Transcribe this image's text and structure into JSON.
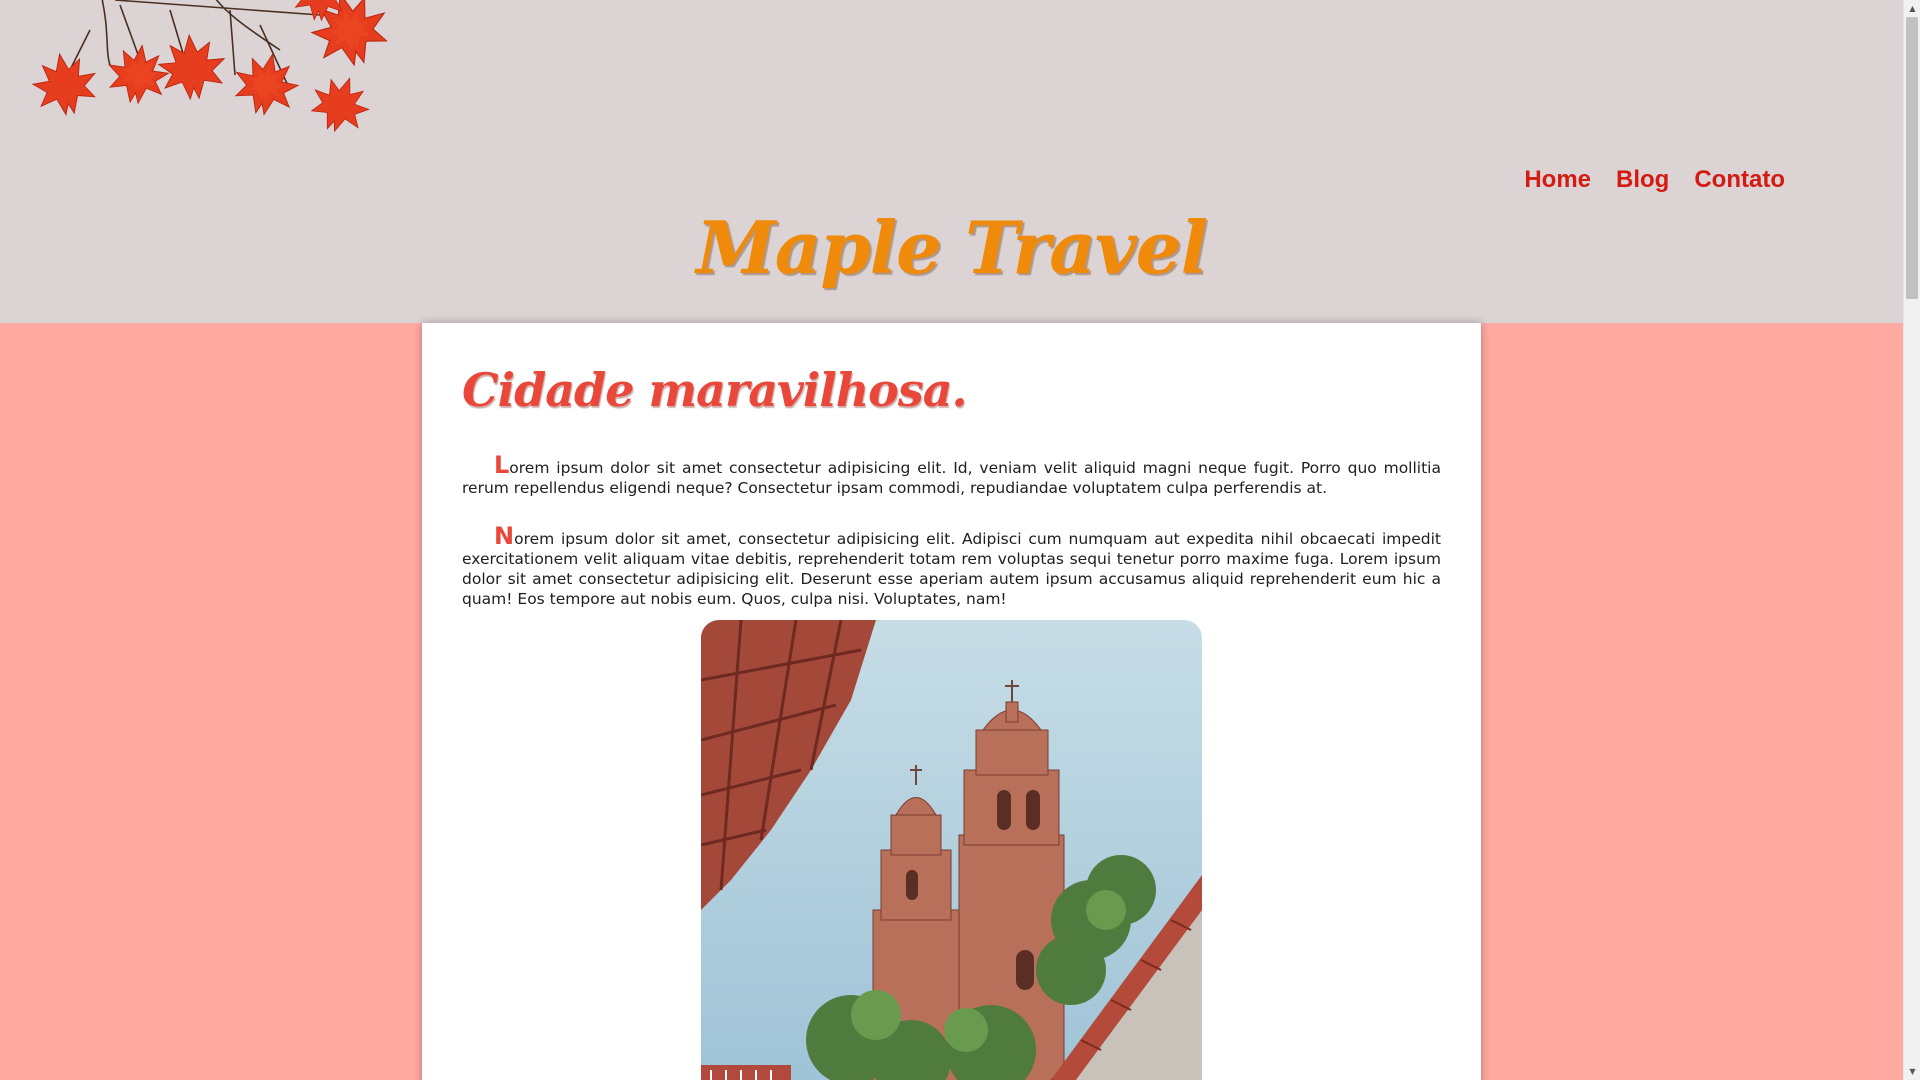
{
  "header": {
    "brand": "Maple Travel",
    "nav": [
      "Home",
      "Blog",
      "Contato"
    ]
  },
  "post": {
    "title": "Cidade maravilhosa.",
    "paragraphs": [
      {
        "initial": "L",
        "text": "orem ipsum dolor sit amet consectetur adipisicing elit. Id, veniam velit aliquid magni neque fugit. Porro quo mollitia rerum repellendus eligendi neque? Consectetur ipsam commodi, repudiandae voluptatem culpa perferendis at."
      },
      {
        "initial": "N",
        "text": "orem ipsum dolor sit amet, consectetur adipisicing elit. Adipisci cum numquam aut expedita nihil obcaecati impedit exercitationem velit aliquam vitae debitis, reprehenderit totam rem voluptas sequi tenetur porro maxime fuga. Lorem ipsum dolor sit amet consectetur adipisicing elit. Deserunt esse aperiam autem ipsum accusamus aliquid reprehenderit eum hic a quam! Eos tempore aut nobis eum. Quos, culpa nisi. Voluptates, nam!"
      }
    ]
  },
  "icons": {
    "leaves": "maple-leaves-icon",
    "photo": "church-towers-photo",
    "scroll_up": "scroll-up-arrow-icon",
    "scroll_down": "scroll-down-arrow-icon"
  },
  "colors": {
    "header_bg": "#dcd3d4",
    "page_bg": "#ffa9a0",
    "brand": "#f08a0a",
    "nav": "#d31b13",
    "title": "#e8473a"
  }
}
